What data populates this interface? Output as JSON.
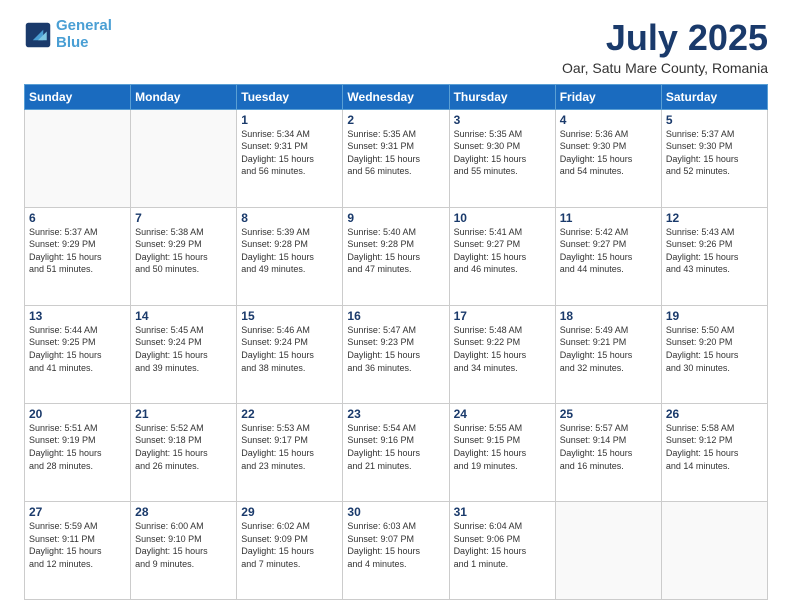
{
  "header": {
    "logo_line1": "General",
    "logo_line2": "Blue",
    "month_title": "July 2025",
    "subtitle": "Oar, Satu Mare County, Romania"
  },
  "weekdays": [
    "Sunday",
    "Monday",
    "Tuesday",
    "Wednesday",
    "Thursday",
    "Friday",
    "Saturday"
  ],
  "weeks": [
    [
      {
        "day": "",
        "info": ""
      },
      {
        "day": "",
        "info": ""
      },
      {
        "day": "1",
        "info": "Sunrise: 5:34 AM\nSunset: 9:31 PM\nDaylight: 15 hours\nand 56 minutes."
      },
      {
        "day": "2",
        "info": "Sunrise: 5:35 AM\nSunset: 9:31 PM\nDaylight: 15 hours\nand 56 minutes."
      },
      {
        "day": "3",
        "info": "Sunrise: 5:35 AM\nSunset: 9:30 PM\nDaylight: 15 hours\nand 55 minutes."
      },
      {
        "day": "4",
        "info": "Sunrise: 5:36 AM\nSunset: 9:30 PM\nDaylight: 15 hours\nand 54 minutes."
      },
      {
        "day": "5",
        "info": "Sunrise: 5:37 AM\nSunset: 9:30 PM\nDaylight: 15 hours\nand 52 minutes."
      }
    ],
    [
      {
        "day": "6",
        "info": "Sunrise: 5:37 AM\nSunset: 9:29 PM\nDaylight: 15 hours\nand 51 minutes."
      },
      {
        "day": "7",
        "info": "Sunrise: 5:38 AM\nSunset: 9:29 PM\nDaylight: 15 hours\nand 50 minutes."
      },
      {
        "day": "8",
        "info": "Sunrise: 5:39 AM\nSunset: 9:28 PM\nDaylight: 15 hours\nand 49 minutes."
      },
      {
        "day": "9",
        "info": "Sunrise: 5:40 AM\nSunset: 9:28 PM\nDaylight: 15 hours\nand 47 minutes."
      },
      {
        "day": "10",
        "info": "Sunrise: 5:41 AM\nSunset: 9:27 PM\nDaylight: 15 hours\nand 46 minutes."
      },
      {
        "day": "11",
        "info": "Sunrise: 5:42 AM\nSunset: 9:27 PM\nDaylight: 15 hours\nand 44 minutes."
      },
      {
        "day": "12",
        "info": "Sunrise: 5:43 AM\nSunset: 9:26 PM\nDaylight: 15 hours\nand 43 minutes."
      }
    ],
    [
      {
        "day": "13",
        "info": "Sunrise: 5:44 AM\nSunset: 9:25 PM\nDaylight: 15 hours\nand 41 minutes."
      },
      {
        "day": "14",
        "info": "Sunrise: 5:45 AM\nSunset: 9:24 PM\nDaylight: 15 hours\nand 39 minutes."
      },
      {
        "day": "15",
        "info": "Sunrise: 5:46 AM\nSunset: 9:24 PM\nDaylight: 15 hours\nand 38 minutes."
      },
      {
        "day": "16",
        "info": "Sunrise: 5:47 AM\nSunset: 9:23 PM\nDaylight: 15 hours\nand 36 minutes."
      },
      {
        "day": "17",
        "info": "Sunrise: 5:48 AM\nSunset: 9:22 PM\nDaylight: 15 hours\nand 34 minutes."
      },
      {
        "day": "18",
        "info": "Sunrise: 5:49 AM\nSunset: 9:21 PM\nDaylight: 15 hours\nand 32 minutes."
      },
      {
        "day": "19",
        "info": "Sunrise: 5:50 AM\nSunset: 9:20 PM\nDaylight: 15 hours\nand 30 minutes."
      }
    ],
    [
      {
        "day": "20",
        "info": "Sunrise: 5:51 AM\nSunset: 9:19 PM\nDaylight: 15 hours\nand 28 minutes."
      },
      {
        "day": "21",
        "info": "Sunrise: 5:52 AM\nSunset: 9:18 PM\nDaylight: 15 hours\nand 26 minutes."
      },
      {
        "day": "22",
        "info": "Sunrise: 5:53 AM\nSunset: 9:17 PM\nDaylight: 15 hours\nand 23 minutes."
      },
      {
        "day": "23",
        "info": "Sunrise: 5:54 AM\nSunset: 9:16 PM\nDaylight: 15 hours\nand 21 minutes."
      },
      {
        "day": "24",
        "info": "Sunrise: 5:55 AM\nSunset: 9:15 PM\nDaylight: 15 hours\nand 19 minutes."
      },
      {
        "day": "25",
        "info": "Sunrise: 5:57 AM\nSunset: 9:14 PM\nDaylight: 15 hours\nand 16 minutes."
      },
      {
        "day": "26",
        "info": "Sunrise: 5:58 AM\nSunset: 9:12 PM\nDaylight: 15 hours\nand 14 minutes."
      }
    ],
    [
      {
        "day": "27",
        "info": "Sunrise: 5:59 AM\nSunset: 9:11 PM\nDaylight: 15 hours\nand 12 minutes."
      },
      {
        "day": "28",
        "info": "Sunrise: 6:00 AM\nSunset: 9:10 PM\nDaylight: 15 hours\nand 9 minutes."
      },
      {
        "day": "29",
        "info": "Sunrise: 6:02 AM\nSunset: 9:09 PM\nDaylight: 15 hours\nand 7 minutes."
      },
      {
        "day": "30",
        "info": "Sunrise: 6:03 AM\nSunset: 9:07 PM\nDaylight: 15 hours\nand 4 minutes."
      },
      {
        "day": "31",
        "info": "Sunrise: 6:04 AM\nSunset: 9:06 PM\nDaylight: 15 hours\nand 1 minute."
      },
      {
        "day": "",
        "info": ""
      },
      {
        "day": "",
        "info": ""
      }
    ]
  ]
}
